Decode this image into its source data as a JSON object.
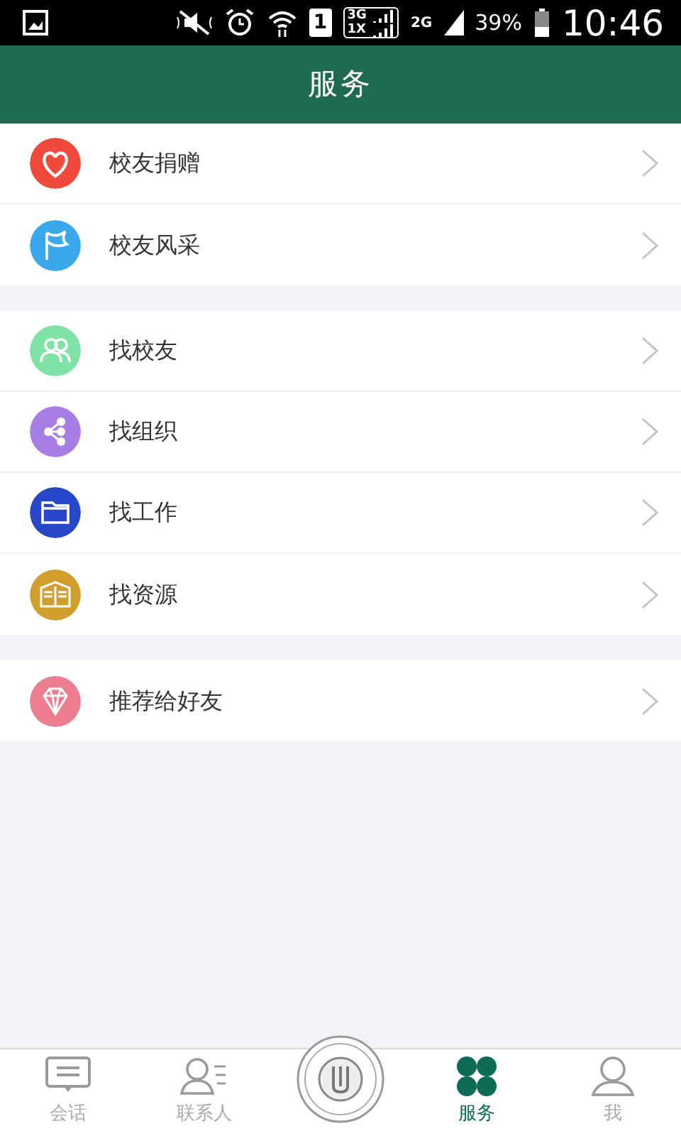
{
  "status_bar": {
    "sim_slot": "1",
    "network_top": "3G",
    "network_bottom": "1X",
    "network_second": "2G",
    "battery": "39%",
    "time": "10:46"
  },
  "header": {
    "title": "服务"
  },
  "groups": [
    {
      "items": [
        {
          "label": "校友捐赠",
          "kind": "heart",
          "color": "#ef4a3c"
        },
        {
          "label": "校友风采",
          "kind": "flag",
          "color": "#3aa9ec"
        }
      ]
    },
    {
      "items": [
        {
          "label": "找校友",
          "kind": "people",
          "color": "#7fe3a6"
        },
        {
          "label": "找组织",
          "kind": "tree",
          "color": "#a77fe4"
        },
        {
          "label": "找工作",
          "kind": "folder",
          "color": "#2747c8"
        },
        {
          "label": "找资源",
          "kind": "book",
          "color": "#cf9e2c"
        }
      ]
    },
    {
      "items": [
        {
          "label": "推荐给好友",
          "kind": "diamond",
          "color": "#ec7e90"
        }
      ]
    }
  ],
  "tab_bar": [
    {
      "kind": "chat",
      "label": "会话",
      "selected": false
    },
    {
      "kind": "contacts",
      "label": "联系人",
      "selected": false
    },
    {
      "kind": "logo"
    },
    {
      "kind": "clover",
      "label": "服务",
      "selected": true
    },
    {
      "kind": "person",
      "label": "我",
      "selected": false
    }
  ]
}
